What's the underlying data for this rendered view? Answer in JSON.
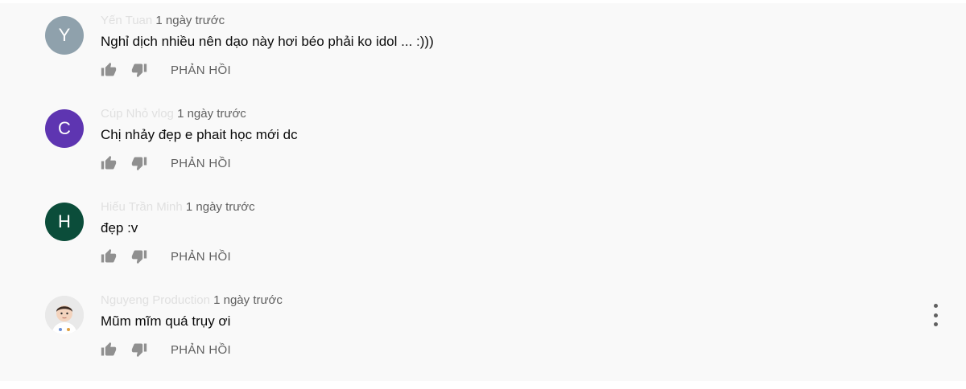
{
  "comments": [
    {
      "avatar_letter": "Y",
      "avatar_color": "#8fa1ac",
      "author": "Yến Tuan",
      "time": "1 ngày trước",
      "text": "Nghỉ dịch nhiều nên dạo này hơi béo phải ko idol ... :)))",
      "reply_label": "PHẢN HỒI"
    },
    {
      "avatar_letter": "C",
      "avatar_color": "#5e35b1",
      "author": "Cúp Nhỏ vlog",
      "time": "1 ngày trước",
      "text": "Chị nhảy đẹp e phait học mới dc",
      "reply_label": "PHẢN HỒI"
    },
    {
      "avatar_letter": "H",
      "avatar_color": "#0b4d3a",
      "author": "Hiếu Trần Minh",
      "time": "1 ngày trước",
      "text": "đẹp :v",
      "reply_label": "PHẢN HỒI"
    },
    {
      "avatar_letter": "",
      "avatar_color": "#e6e6e6",
      "author": "Nguyeng Production",
      "time": "1 ngày trước",
      "text": "Mũm mĩm quá trụy ơi",
      "reply_label": "PHẢN HỒI"
    }
  ]
}
